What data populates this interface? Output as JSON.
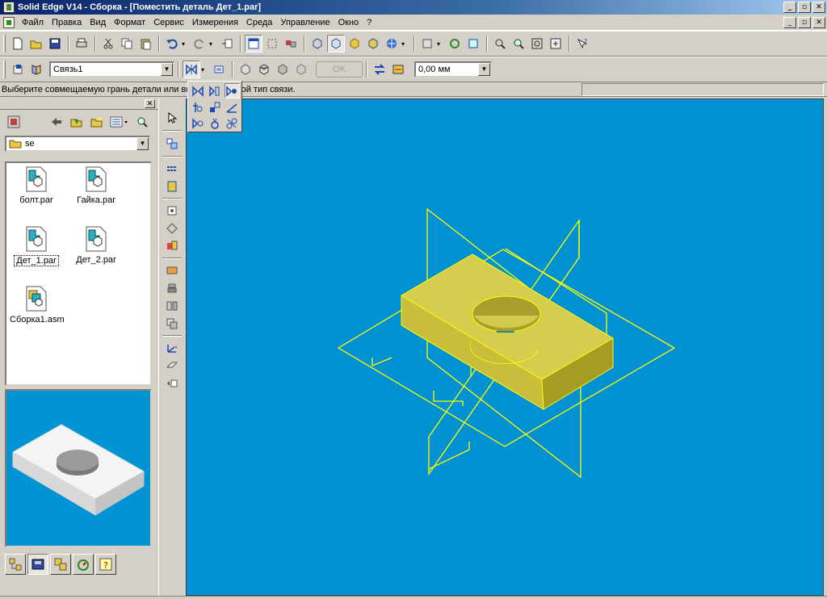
{
  "window": {
    "title": "Solid Edge V14 - Сборка - [Поместить деталь Дет_1.par]",
    "minimize": "_",
    "restore": "▫",
    "close": "✕"
  },
  "menu": {
    "items": [
      "Файл",
      "Правка",
      "Вид",
      "Формат",
      "Сервис",
      "Измерения",
      "Среда",
      "Управление",
      "Окно",
      "?"
    ]
  },
  "ribbon": {
    "relation_value": "Связь1",
    "ok_label": "OK",
    "offset_value": "0,00 мм"
  },
  "status": {
    "prompt": "Выберите совмещаемую грань детали или выберите другой тип связи."
  },
  "library": {
    "folder": "se",
    "files": [
      {
        "name": "болт.par",
        "type": "part",
        "selected": false
      },
      {
        "name": "Гайка.par",
        "type": "part",
        "selected": false
      },
      {
        "name": "Дет_1.par",
        "type": "part",
        "selected": true
      },
      {
        "name": "Дет_2.par",
        "type": "part",
        "selected": false
      },
      {
        "name": "Сборка1.asm",
        "type": "assembly",
        "selected": false
      }
    ]
  },
  "colors": {
    "viewport_bg": "#0091d3",
    "part_fill": "#c8c23a",
    "wireframe": "#ffff00",
    "titlebar_start": "#0a246a"
  }
}
